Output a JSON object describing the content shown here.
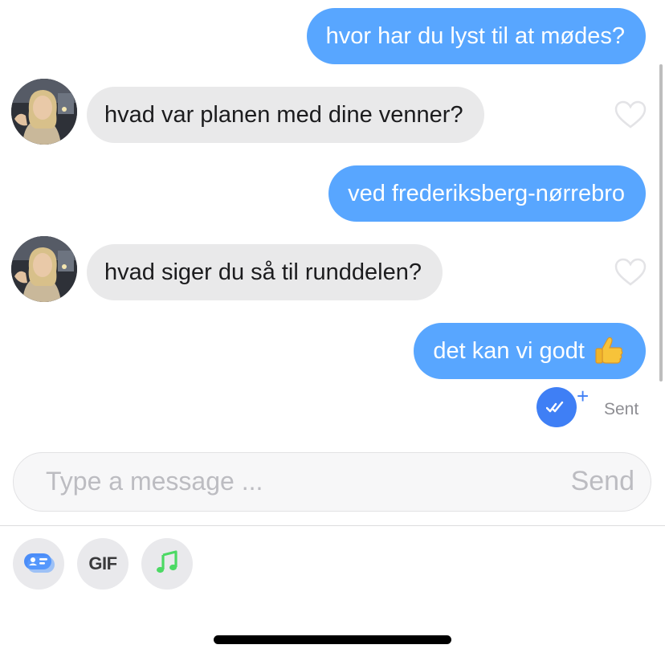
{
  "messages": [
    {
      "direction": "outgoing",
      "text": "hvor har du lyst til at mødes?"
    },
    {
      "direction": "incoming",
      "text": "hvad var planen med dine venner?"
    },
    {
      "direction": "outgoing",
      "text": "ved frederiksberg-nørrebro"
    },
    {
      "direction": "incoming",
      "text": "hvad siger du så til runddelen?"
    },
    {
      "direction": "outgoing",
      "text": "det kan vi godt",
      "emoji": "thumbs-up"
    }
  ],
  "receipt": {
    "status": "Sent",
    "plus": "+",
    "icon": "double-check-icon"
  },
  "composer": {
    "placeholder": "Type a message ...",
    "value": "",
    "send_label": "Send"
  },
  "toolbar": {
    "contact_card_icon": "contact-card-icon",
    "gif_label": "GIF",
    "music_icon": "music-note-icon"
  },
  "colors": {
    "outgoing_bubble": "#58a6ff",
    "incoming_bubble": "#e9e9ea",
    "receipt_accent": "#3f7ff5",
    "music_green": "#4cd964"
  }
}
